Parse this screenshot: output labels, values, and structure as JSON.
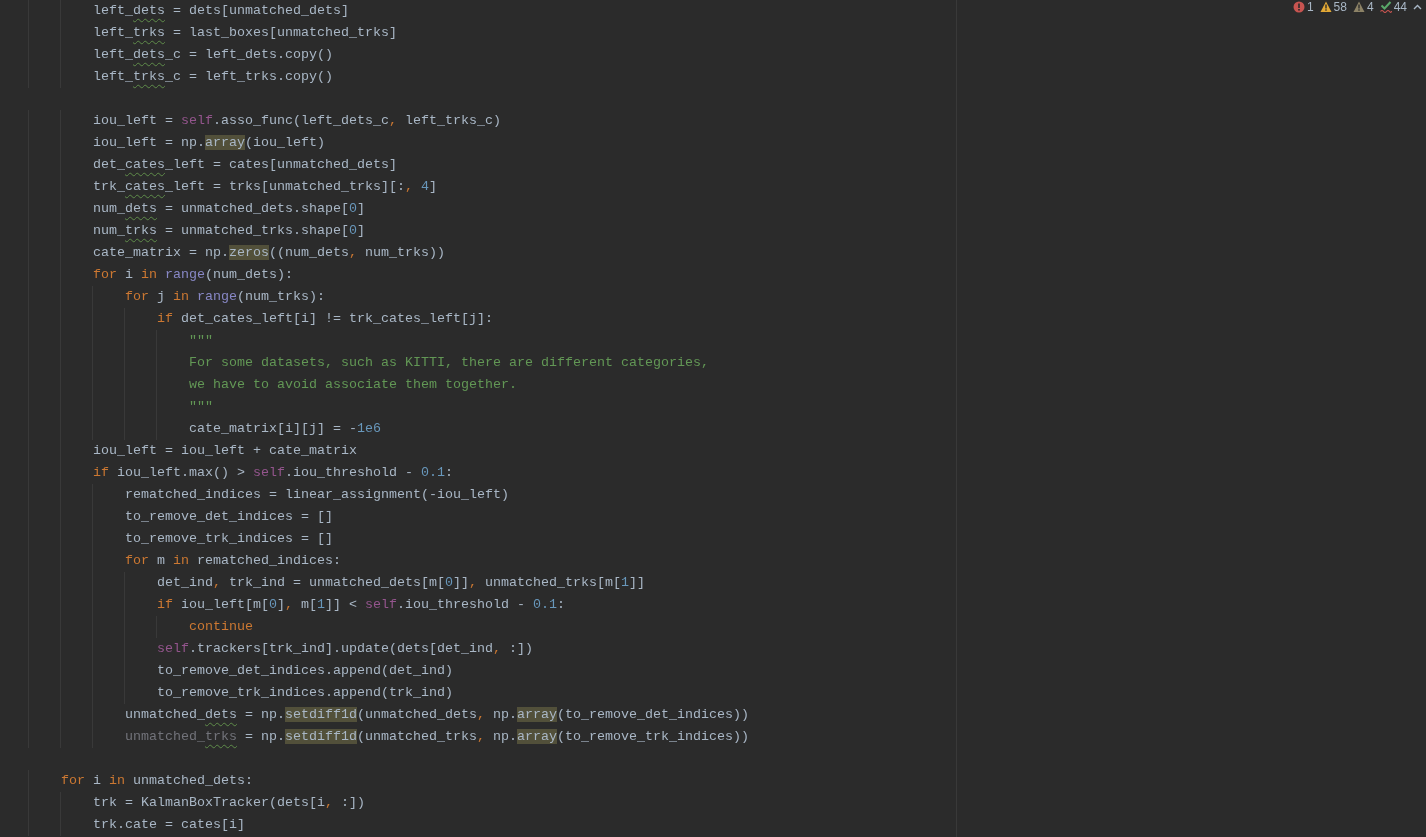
{
  "inspections": [
    {
      "kind": "error",
      "count": "1"
    },
    {
      "kind": "warning",
      "count": "58"
    },
    {
      "kind": "weak",
      "count": "4"
    },
    {
      "kind": "typo",
      "count": "44"
    }
  ],
  "lines": [
    {
      "kind": "block",
      "children": [
        {
          "kind": "block",
          "children": [
            {
              "kind": "code",
              "segments": [
                {
                  "text": "left_"
                },
                {
                  "text": "dets",
                  "typo": true
                },
                {
                  "text": " = dets[unmatched_dets]"
                }
              ]
            },
            {
              "kind": "code",
              "segments": [
                {
                  "text": "left_"
                },
                {
                  "text": "trks",
                  "typo": true
                },
                {
                  "text": " = last_boxes[unmatched_trks]"
                }
              ]
            },
            {
              "kind": "code",
              "segments": [
                {
                  "text": "left_"
                },
                {
                  "text": "dets",
                  "typo": true
                },
                {
                  "text": "_c = left_dets.copy()"
                }
              ]
            },
            {
              "kind": "code",
              "segments": [
                {
                  "text": "left_"
                },
                {
                  "text": "trks",
                  "typo": true
                },
                {
                  "text": "_c = left_trks.copy()"
                }
              ]
            },
            {
              "kind": "blank"
            },
            {
              "kind": "code",
              "segments": [
                {
                  "text": "iou_left = "
                },
                {
                  "text": "self",
                  "kind": "self"
                },
                {
                  "text": ".asso_func(left_dets_c"
                },
                {
                  "text": ", ",
                  "kind": "punct"
                },
                {
                  "text": "left_trks_c)"
                }
              ]
            },
            {
              "kind": "code",
              "segments": [
                {
                  "text": "iou_left = np."
                },
                {
                  "text": "array",
                  "highlight": true
                },
                {
                  "text": "(iou_left)"
                }
              ]
            },
            {
              "kind": "code",
              "segments": [
                {
                  "text": "det_"
                },
                {
                  "text": "cates",
                  "typo": true
                },
                {
                  "text": "_left = cates[unmatched_dets]"
                }
              ]
            },
            {
              "kind": "code",
              "segments": [
                {
                  "text": "trk_"
                },
                {
                  "text": "cates",
                  "typo": true
                },
                {
                  "text": "_left = trks[unmatched_trks][:"
                },
                {
                  "text": ", ",
                  "kind": "punct"
                },
                {
                  "text": "4",
                  "kind": "number"
                },
                {
                  "text": "]"
                }
              ]
            },
            {
              "kind": "code",
              "segments": [
                {
                  "text": "num_"
                },
                {
                  "text": "dets",
                  "typo": true
                },
                {
                  "text": " = unmatched_dets.shape["
                },
                {
                  "text": "0",
                  "kind": "number"
                },
                {
                  "text": "]"
                }
              ]
            },
            {
              "kind": "code",
              "segments": [
                {
                  "text": "num_"
                },
                {
                  "text": "trks",
                  "typo": true
                },
                {
                  "text": " = unmatched_trks.shape["
                },
                {
                  "text": "0",
                  "kind": "number"
                },
                {
                  "text": "]"
                }
              ]
            },
            {
              "kind": "code",
              "segments": [
                {
                  "text": "cate_matrix = np."
                },
                {
                  "text": "zeros",
                  "highlight": true
                },
                {
                  "text": "((num_dets"
                },
                {
                  "text": ", ",
                  "kind": "punct"
                },
                {
                  "text": "num_trks))"
                }
              ]
            },
            {
              "kind": "code",
              "segments": [
                {
                  "text": "for ",
                  "kind": "keyword"
                },
                {
                  "text": "i "
                },
                {
                  "text": "in ",
                  "kind": "keyword"
                },
                {
                  "text": "range",
                  "kind": "builtin"
                },
                {
                  "text": "(num_dets):"
                }
              ],
              "children": [
                {
                  "kind": "code",
                  "segments": [
                    {
                      "text": "for ",
                      "kind": "keyword"
                    },
                    {
                      "text": "j "
                    },
                    {
                      "text": "in ",
                      "kind": "keyword"
                    },
                    {
                      "text": "range",
                      "kind": "builtin"
                    },
                    {
                      "text": "(num_trks):"
                    }
                  ],
                  "children": [
                    {
                      "kind": "code",
                      "segments": [
                        {
                          "text": "if ",
                          "kind": "keyword"
                        },
                        {
                          "text": "det_cates_left[i] != trk_cates_left[j]:"
                        }
                      ],
                      "children": [
                        {
                          "kind": "code",
                          "segments": [
                            {
                              "text": "\"\"\"",
                              "kind": "doc"
                            }
                          ]
                        },
                        {
                          "kind": "code",
                          "segments": [
                            {
                              "text": "For some datasets, such as KITTI, there are different categories,",
                              "kind": "doc"
                            }
                          ]
                        },
                        {
                          "kind": "code",
                          "segments": [
                            {
                              "text": "we have to avoid associate them together.",
                              "kind": "doc"
                            }
                          ]
                        },
                        {
                          "kind": "code",
                          "segments": [
                            {
                              "text": "\"\"\"",
                              "kind": "doc"
                            }
                          ]
                        },
                        {
                          "kind": "code",
                          "segments": [
                            {
                              "text": "cate_matrix[i][j] = -"
                            },
                            {
                              "text": "1e6",
                              "kind": "number"
                            }
                          ]
                        }
                      ]
                    }
                  ]
                }
              ]
            },
            {
              "kind": "code",
              "segments": [
                {
                  "text": "iou_left = iou_left + cate_matrix"
                }
              ]
            },
            {
              "kind": "code",
              "segments": [
                {
                  "text": "if ",
                  "kind": "keyword"
                },
                {
                  "text": "iou_left.max() > "
                },
                {
                  "text": "self",
                  "kind": "self"
                },
                {
                  "text": ".iou_threshold - "
                },
                {
                  "text": "0.1",
                  "kind": "number"
                },
                {
                  "text": ":"
                }
              ],
              "children": [
                {
                  "kind": "code",
                  "segments": [
                    {
                      "text": "rematched_indices = linear_assignment(-iou_left)"
                    }
                  ]
                },
                {
                  "kind": "code",
                  "segments": [
                    {
                      "text": "to_remove_det_indices = []"
                    }
                  ]
                },
                {
                  "kind": "code",
                  "segments": [
                    {
                      "text": "to_remove_trk_indices = []"
                    }
                  ]
                },
                {
                  "kind": "code",
                  "segments": [
                    {
                      "text": "for ",
                      "kind": "keyword"
                    },
                    {
                      "text": "m "
                    },
                    {
                      "text": "in ",
                      "kind": "keyword"
                    },
                    {
                      "text": "rematched_indices:"
                    }
                  ],
                  "children": [
                    {
                      "kind": "code",
                      "segments": [
                        {
                          "text": "det_ind"
                        },
                        {
                          "text": ", ",
                          "kind": "punct"
                        },
                        {
                          "text": "trk_ind = unmatched_dets[m["
                        },
                        {
                          "text": "0",
                          "kind": "number"
                        },
                        {
                          "text": "]]"
                        },
                        {
                          "text": ", ",
                          "kind": "punct"
                        },
                        {
                          "text": "unmatched_trks[m["
                        },
                        {
                          "text": "1",
                          "kind": "number"
                        },
                        {
                          "text": "]]"
                        }
                      ]
                    },
                    {
                      "kind": "code",
                      "segments": [
                        {
                          "text": "if ",
                          "kind": "keyword"
                        },
                        {
                          "text": "iou_left[m["
                        },
                        {
                          "text": "0",
                          "kind": "number"
                        },
                        {
                          "text": "]"
                        },
                        {
                          "text": ", ",
                          "kind": "punct"
                        },
                        {
                          "text": "m["
                        },
                        {
                          "text": "1",
                          "kind": "number"
                        },
                        {
                          "text": "]] < "
                        },
                        {
                          "text": "self",
                          "kind": "self"
                        },
                        {
                          "text": ".iou_threshold - "
                        },
                        {
                          "text": "0.1",
                          "kind": "number"
                        },
                        {
                          "text": ":"
                        }
                      ],
                      "children": [
                        {
                          "kind": "code",
                          "segments": [
                            {
                              "text": "continue",
                              "kind": "keyword"
                            }
                          ]
                        }
                      ]
                    },
                    {
                      "kind": "code",
                      "segments": [
                        {
                          "text": "self",
                          "kind": "self"
                        },
                        {
                          "text": ".trackers[trk_ind].update(dets[det_ind"
                        },
                        {
                          "text": ", ",
                          "kind": "punct"
                        },
                        {
                          "text": ":])"
                        }
                      ]
                    },
                    {
                      "kind": "code",
                      "segments": [
                        {
                          "text": "to_remove_det_indices.append(det_ind)"
                        }
                      ]
                    },
                    {
                      "kind": "code",
                      "segments": [
                        {
                          "text": "to_remove_trk_indices.append(trk_ind)"
                        }
                      ]
                    }
                  ]
                },
                {
                  "kind": "code",
                  "segments": [
                    {
                      "text": "unmatched_"
                    },
                    {
                      "text": "dets",
                      "typo": true
                    },
                    {
                      "text": " = np."
                    },
                    {
                      "text": "setdiff1d",
                      "highlight": true
                    },
                    {
                      "text": "(unmatched_dets"
                    },
                    {
                      "text": ", ",
                      "kind": "punct"
                    },
                    {
                      "text": "np."
                    },
                    {
                      "text": "array",
                      "highlight": true
                    },
                    {
                      "text": "(to_remove_det_indices))"
                    }
                  ]
                },
                {
                  "kind": "code",
                  "segments": [
                    {
                      "text": "unmatched_",
                      "kind": "unused"
                    },
                    {
                      "text": "trks",
                      "kind": "unused",
                      "typo": true
                    },
                    {
                      "text": " = np."
                    },
                    {
                      "text": "setdiff1d",
                      "highlight": true
                    },
                    {
                      "text": "(unmatched_trks"
                    },
                    {
                      "text": ", ",
                      "kind": "punct"
                    },
                    {
                      "text": "np."
                    },
                    {
                      "text": "array",
                      "highlight": true
                    },
                    {
                      "text": "(to_remove_trk_indices))"
                    }
                  ]
                }
              ]
            }
          ]
        },
        {
          "kind": "blank"
        },
        {
          "kind": "code",
          "segments": [
            {
              "text": "for ",
              "kind": "keyword"
            },
            {
              "text": "i "
            },
            {
              "text": "in ",
              "kind": "keyword"
            },
            {
              "text": "unmatched_dets:"
            }
          ],
          "children": [
            {
              "kind": "code",
              "segments": [
                {
                  "text": "trk = KalmanBoxTracker(dets[i"
                },
                {
                  "text": ", ",
                  "kind": "punct"
                },
                {
                  "text": ":])"
                }
              ]
            },
            {
              "kind": "code",
              "segments": [
                {
                  "text": "trk.cate = cates[i]"
                }
              ]
            }
          ]
        }
      ]
    }
  ]
}
